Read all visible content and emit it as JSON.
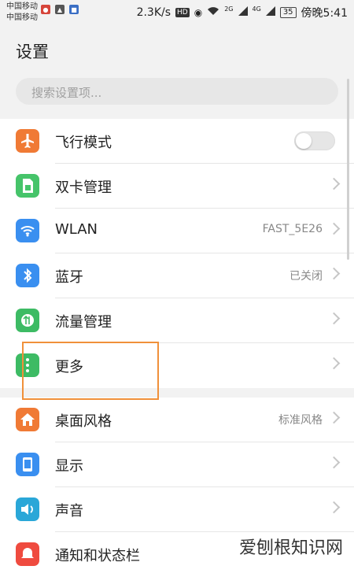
{
  "status_bar": {
    "carrier_1": "中国移动",
    "carrier_2": "中国移动",
    "network_speed": "2.3K/s",
    "hd_label": "HD",
    "signal_1": "2G",
    "signal_2": "4G",
    "battery": "35",
    "time": "傍晚5:41"
  },
  "header": {
    "title": "设置"
  },
  "search": {
    "placeholder": "搜索设置项..."
  },
  "group_1": {
    "items": [
      {
        "label": "飞行模式",
        "value": "",
        "icon": "airplane-icon",
        "icon_color": "#f07a35"
      },
      {
        "label": "双卡管理",
        "value": "",
        "icon": "sim-card-icon",
        "icon_color": "#46c46a"
      },
      {
        "label": "WLAN",
        "value": "FAST_5E26",
        "icon": "wifi-icon",
        "icon_color": "#3a8ff0"
      },
      {
        "label": "蓝牙",
        "value": "已关闭",
        "icon": "bluetooth-icon",
        "icon_color": "#3a8ff0"
      },
      {
        "label": "流量管理",
        "value": "",
        "icon": "data-usage-icon",
        "icon_color": "#3dbb64"
      },
      {
        "label": "更多",
        "value": "",
        "icon": "more-icon",
        "icon_color": "#3dbb64"
      }
    ]
  },
  "group_2": {
    "items": [
      {
        "label": "桌面风格",
        "value": "标准风格",
        "icon": "home-icon",
        "icon_color": "#f07a35"
      },
      {
        "label": "显示",
        "value": "",
        "icon": "display-icon",
        "icon_color": "#3a8ff0"
      },
      {
        "label": "声音",
        "value": "",
        "icon": "sound-icon",
        "icon_color": "#2aa7d8"
      },
      {
        "label": "通知和状态栏",
        "value": "",
        "icon": "notification-icon",
        "icon_color": "#ef4b3f"
      }
    ]
  },
  "watermark": "爱刨根知识网"
}
